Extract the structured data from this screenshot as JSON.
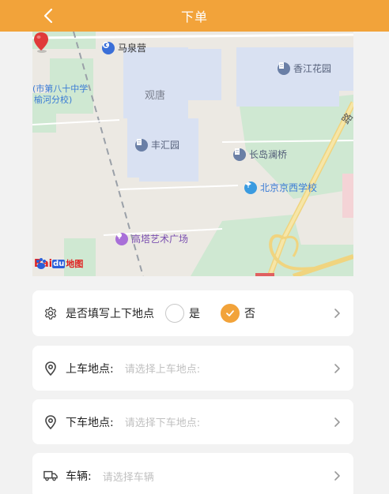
{
  "header": {
    "title": "下单",
    "back_icon": "chevron-left-icon"
  },
  "map": {
    "area_label": "观唐",
    "pois": [
      {
        "id": "maquanying",
        "label": "马泉营",
        "icon": "subway-icon"
      },
      {
        "id": "xiangjiang",
        "label": "香江花园",
        "icon": "building-icon"
      },
      {
        "id": "fenghui",
        "label": "丰汇园",
        "icon": "building-icon"
      },
      {
        "id": "changdao",
        "label": "长岛澜桥",
        "icon": "building-icon"
      },
      {
        "id": "jingxi",
        "label": "北京京西学校",
        "icon": "school-icon"
      },
      {
        "id": "gaota",
        "label": "高塔艺术广场",
        "icon": "park-icon"
      }
    ],
    "school_line1": "(市第八十中学",
    "school_line2": "榆河分校)",
    "road_label": "路",
    "logo_bai": "Bai",
    "logo_du": "du",
    "logo_map": "地图"
  },
  "form": {
    "fill_points": {
      "label": "是否填写上下地点",
      "option_yes": "是",
      "option_no": "否",
      "selected": "否"
    },
    "pickup": {
      "label": "上车地点:",
      "placeholder": "请选择上车地点:"
    },
    "dropoff": {
      "label": "下车地点:",
      "placeholder": "请选择下车地点:"
    },
    "vehicle": {
      "label": "车辆:",
      "placeholder": "请选择车辆"
    }
  },
  "colors": {
    "accent": "#f2a33a",
    "background": "#f2f2f2"
  }
}
